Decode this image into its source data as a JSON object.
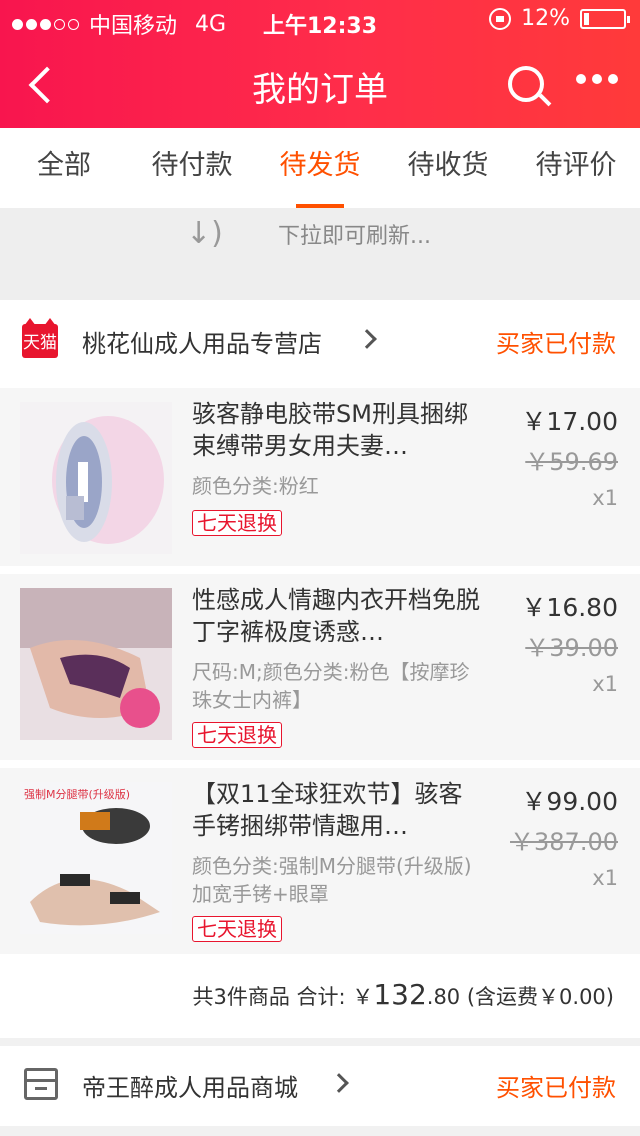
{
  "status_bar": {
    "carrier": "中国移动",
    "network": "4G",
    "time": "上午12:33",
    "battery": "12%",
    "battery_level": 0.12
  },
  "nav": {
    "title": "我的订单"
  },
  "tabs": [
    {
      "label": "全部",
      "active": false
    },
    {
      "label": "待付款",
      "active": false
    },
    {
      "label": "待发货",
      "active": true
    },
    {
      "label": "待收货",
      "active": false
    },
    {
      "label": "待评价",
      "active": false
    }
  ],
  "refresh": {
    "text": "下拉即可刷新..."
  },
  "orders": [
    {
      "shop_badge": "天猫",
      "shop_name": "桃花仙成人用品专营店",
      "status": "买家已付款",
      "items": [
        {
          "name": "骇客静电胶带SM刑具捆绑束缚带男女用夫妻…",
          "spec": "颜色分类:粉红",
          "badge": "七天退换",
          "price": "￥17.00",
          "original_price": "￥59.69",
          "qty": "x1"
        },
        {
          "name": "性感成人情趣内衣开档免脱丁字裤极度诱惑…",
          "spec": "尺码:M;颜色分类:粉色【按摩珍珠女士内裤】",
          "badge": "七天退换",
          "price": "￥16.80",
          "original_price": "￥39.00",
          "qty": "x1"
        },
        {
          "name": "【双11全球狂欢节】骇客手铐捆绑带情趣用…",
          "spec": "颜色分类:强制M分腿带(升级版)加宽手铐+眼罩",
          "badge": "七天退换",
          "price": "￥99.00",
          "original_price": "￥387.00",
          "qty": "x1",
          "thumb_label": "强制M分腿带(升级版)"
        }
      ],
      "summary": {
        "prefix": "共3件商品 合计: ￥",
        "total_int": "132",
        "total_dec": ".80",
        "shipping": " (含运费￥0.00)"
      }
    },
    {
      "shop_name": "帝王醉成人用品商城",
      "status": "买家已付款"
    }
  ],
  "colors": {
    "accent": "#ff5000",
    "header_gradient_start": "#f8154e",
    "header_gradient_end": "#ff3a3a",
    "badge_red": "#e8152e"
  }
}
